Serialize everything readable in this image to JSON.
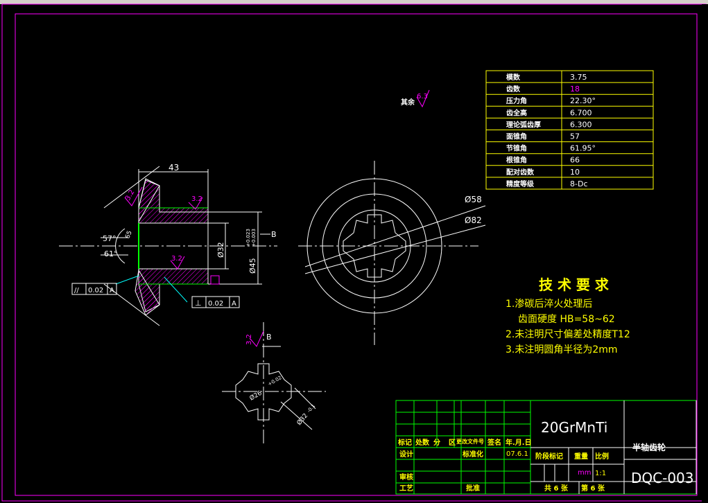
{
  "drawing": {
    "surface_roughness_note": {
      "label": "其余",
      "value": "6.3"
    },
    "roughness_values": [
      "3.2",
      "3.2",
      "3.2",
      "3.2",
      "3.2"
    ],
    "dimensions": {
      "width_43": "43",
      "angle_57": "57°",
      "angle_61": "61°",
      "angle_65": "65",
      "dia_32": "Ø32",
      "dia_45": "Ø45",
      "tol_45": "+0.023",
      "tol_45_low": "+0.003",
      "dia_58": "Ø58",
      "dia_82": "Ø82",
      "dia_26": "Ø26",
      "tol_26": "+0.02",
      "dia_32b": "Ø32",
      "tol_32b": "-0.1",
      "datum_b": "B",
      "datum_b2": "B"
    },
    "tolerance_frames": [
      {
        "symbol": "//",
        "value": "0.02",
        "datum": "A"
      },
      {
        "symbol": "⊥",
        "value": "0.02",
        "datum": "A"
      }
    ],
    "gear_table": [
      {
        "label": "模数",
        "value": "3.75"
      },
      {
        "label": "齿数",
        "value": "18"
      },
      {
        "label": "压力角",
        "value": "22.30°"
      },
      {
        "label": "齿全高",
        "value": "6.700"
      },
      {
        "label": "理论弧齿厚",
        "value": "6.300"
      },
      {
        "label": "面锥角",
        "value": "57"
      },
      {
        "label": "节锥角",
        "value": "61.95°"
      },
      {
        "label": "根锥角",
        "value": "66"
      },
      {
        "label": "配对齿数",
        "value": "10"
      },
      {
        "label": "精度等级",
        "value": "8-Dc"
      }
    ],
    "tech_requirements": {
      "title": "技 术 要 求",
      "line1": "1.渗碳后淬火处理后",
      "line2": "齿面硬度   HB=58~62",
      "line3": "2.未注明尺寸偏差处精度T12",
      "line4": "3.未注明圆角半径为2mm"
    },
    "title_block": {
      "material": "20GrMnTi",
      "part_name": "半轴齿轮",
      "drawing_no": "DQC-003",
      "headers": [
        "标记",
        "处数",
        "分",
        "区",
        "更改文件号",
        "签名",
        "年.月.日"
      ],
      "design": "设计",
      "standardize": "标准化",
      "date": "07.6.1",
      "stage_mark": "阶段标记",
      "weight": "重量",
      "scale": "比例",
      "unit": "mm",
      "scale_value": "1:1",
      "review": "审核",
      "process": "工艺",
      "approve": "批准",
      "sheets_total": "共 6 张",
      "sheet_no": "第 6 张"
    },
    "colors": {
      "line_white": "#ffffff",
      "line_yellow": "#ffff00",
      "line_green": "#00ff00",
      "line_magenta": "#ff00ff",
      "line_cyan": "#00ffff",
      "background": "#000000"
    }
  }
}
